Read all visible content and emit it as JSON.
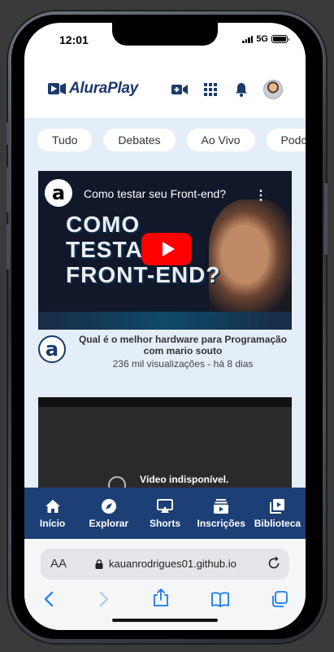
{
  "status_bar": {
    "time": "12:01",
    "network": "5G"
  },
  "header": {
    "logo_text": "AluraPlay",
    "icons": [
      "video-add-icon",
      "apps-grid-icon",
      "bell-icon",
      "avatar"
    ]
  },
  "chips": [
    "Tudo",
    "Debates",
    "Ao Vivo",
    "Podcasts"
  ],
  "videos": [
    {
      "thumbnail_title": "Como testar seu Front-end?",
      "thumbnail_text": [
        "COMO",
        "TESTAR",
        "FRONT-END?"
      ],
      "channel_initial": "a",
      "title": "Qual é o melhor hardware para Programação com mario souto",
      "stats": "236 mil visualizações - há 8 dias"
    },
    {
      "unavailable_text": "Vídeo indisponível."
    }
  ],
  "bottom_nav": [
    {
      "label": "Início",
      "icon": "home-icon"
    },
    {
      "label": "Explorar",
      "icon": "compass-icon"
    },
    {
      "label": "Shorts",
      "icon": "cast-icon"
    },
    {
      "label": "Inscrições",
      "icon": "subscriptions-icon"
    },
    {
      "label": "Biblioteca",
      "icon": "library-icon"
    }
  ],
  "browser": {
    "text_size_label": "AA",
    "url": "kauanrodrigues01.github.io"
  },
  "colors": {
    "brand_blue": "#1c4076",
    "content_bg": "#e4eef9",
    "play_red": "#ff0000"
  }
}
